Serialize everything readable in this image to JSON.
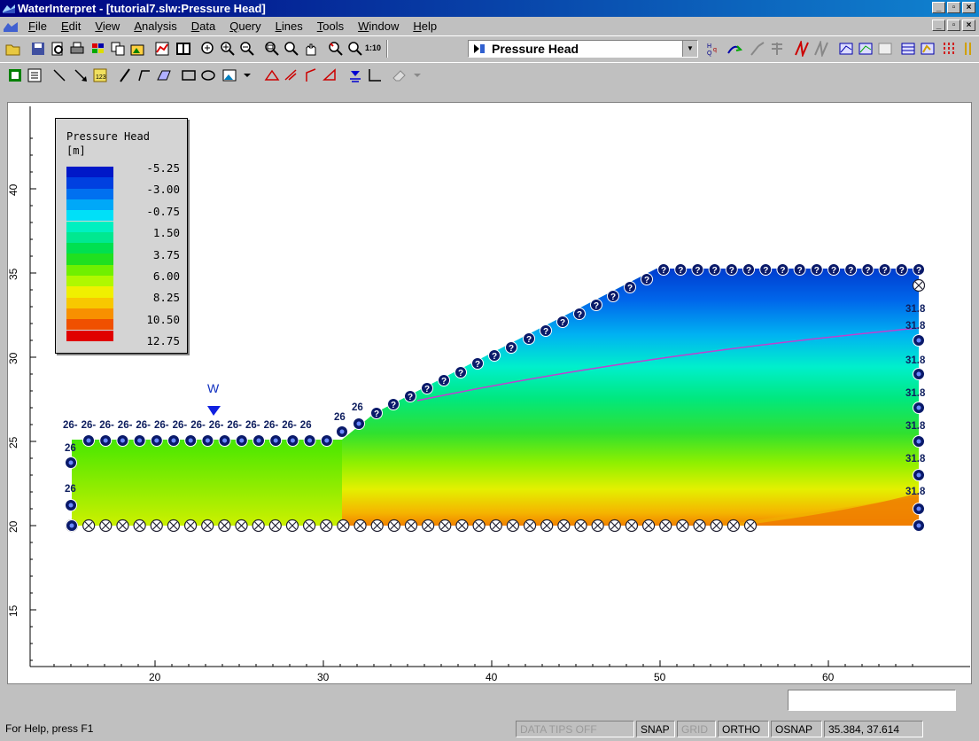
{
  "window": {
    "title": "WaterInterpret - [tutorial7.slw:Pressure Head]"
  },
  "menu": {
    "items": [
      {
        "pre": "",
        "u": "F",
        "post": "ile"
      },
      {
        "pre": "",
        "u": "E",
        "post": "dit"
      },
      {
        "pre": "",
        "u": "V",
        "post": "iew"
      },
      {
        "pre": "",
        "u": "A",
        "post": "nalysis"
      },
      {
        "pre": "",
        "u": "D",
        "post": "ata"
      },
      {
        "pre": "",
        "u": "Q",
        "post": "uery"
      },
      {
        "pre": "",
        "u": "L",
        "post": "ines"
      },
      {
        "pre": "",
        "u": "T",
        "post": "ools"
      },
      {
        "pre": "",
        "u": "W",
        "post": "indow"
      },
      {
        "pre": "",
        "u": "H",
        "post": "elp"
      }
    ]
  },
  "toolbar": {
    "zoom_label": "1:10",
    "data_selector": "Pressure Head"
  },
  "legend": {
    "title": "Pressure Head",
    "unit": "[m]",
    "labels": [
      "-5.25",
      "-3.00",
      "-0.75",
      "1.50",
      "3.75",
      "6.00",
      "8.25",
      "10.50",
      "12.75"
    ],
    "colors": [
      "#0018c8",
      "#0040e0",
      "#0070f0",
      "#00a8f8",
      "#00e0f8",
      "#00f0c0",
      "#00e890",
      "#00e050",
      "#20e020",
      "#70f000",
      "#b0f800",
      "#f0f000",
      "#f8c800",
      "#f89000",
      "#f05000",
      "#e00000"
    ]
  },
  "model": {
    "axis_x_ticks": [
      "20",
      "30",
      "40",
      "50",
      "60"
    ],
    "axis_y_ticks": [
      "40",
      "35",
      "30",
      "25",
      "20",
      "15"
    ],
    "water_table_label": "W",
    "left_head_label": "26",
    "right_head_label": "31.8",
    "unknown_marker": "?"
  },
  "status": {
    "help": "For Help, press F1",
    "data_tips": "DATA TIPS OFF",
    "snap": "SNAP",
    "grid": "GRID",
    "ortho": "ORTHO",
    "osnap": "OSNAP",
    "coords": "35.384, 37.614"
  }
}
